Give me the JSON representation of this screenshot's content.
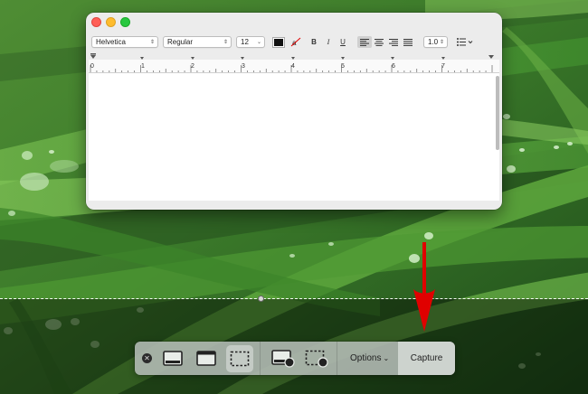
{
  "window": {
    "traffic_lights": [
      "close",
      "minimize",
      "zoom"
    ],
    "toolbar": {
      "font_family": "Helvetica",
      "font_style": "Regular",
      "font_size": "12",
      "text_color": "#111111",
      "bold_label": "B",
      "italic_label": "I",
      "underline_label": "U",
      "line_spacing": "1.0"
    },
    "ruler_numbers": [
      "0",
      "1",
      "2",
      "3",
      "4",
      "5",
      "6",
      "7"
    ]
  },
  "capture_bar": {
    "close_symbol": "✕",
    "tools": [
      {
        "name": "capture-entire-screen-icon",
        "selected": false
      },
      {
        "name": "capture-selected-window-icon",
        "selected": false
      },
      {
        "name": "capture-selected-portion-icon",
        "selected": true
      },
      {
        "name": "record-entire-screen-icon",
        "selected": false
      },
      {
        "name": "record-selected-portion-icon",
        "selected": false
      }
    ],
    "options_label": "Options",
    "capture_label": "Capture"
  },
  "colors": {
    "arrow": "#e00000",
    "close": "#ff5f57",
    "minimize": "#febc2e",
    "zoom": "#28c840"
  }
}
